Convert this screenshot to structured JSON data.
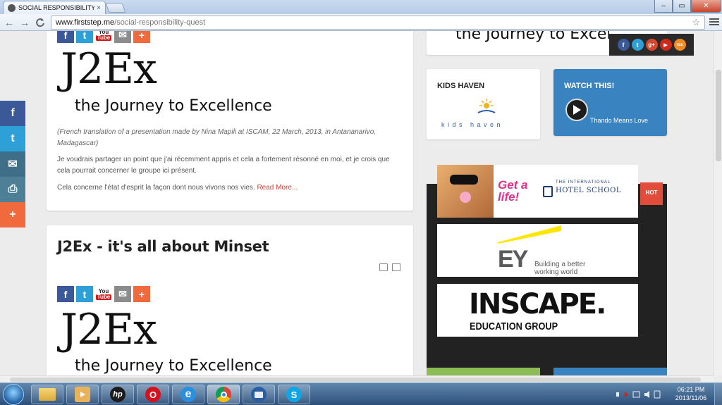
{
  "browser": {
    "tab_title": "SOCIAL RESPONSIBILITY Q",
    "tab_close": "×",
    "url_host": "www.firststep.me",
    "url_path": "/social-responsibility-quest",
    "back": "←",
    "forward": "→",
    "reload": "C",
    "star": "☆",
    "window_min": "–",
    "window_max": "▭",
    "window_close": "✕"
  },
  "float_share": [
    {
      "icon": "facebook-icon",
      "glyph": "f"
    },
    {
      "icon": "twitter-icon",
      "glyph": "t"
    },
    {
      "icon": "email-icon",
      "glyph": "✉"
    },
    {
      "icon": "print-icon",
      "glyph": "⎙"
    },
    {
      "icon": "plus-icon",
      "glyph": "+"
    }
  ],
  "share_icons": {
    "facebook": "f",
    "twitter": "t",
    "youtube_top": "You",
    "youtube_bottom": "Tube",
    "email": "✉",
    "plus": "+"
  },
  "post1": {
    "logo_main": "J2Ex",
    "logo_sub": "the Journey to Excellence",
    "caption": "(French translation of a presentation made by Nina Mapili at ISCAM, 22 March, 2013, in Antananarivo, Madagascar)",
    "para1": "Je voudrais partager un point que j'ai récemment appris et cela a fortement résonné en moi, et je crois que cela pourrait concerner le groupe ici présent.",
    "para2": "Cela concerne l'état d'esprit la façon dont nous vivons nos vies.",
    "read_more": "Read More..."
  },
  "post2": {
    "title": "J2Ex - it's all about Minset",
    "logo_main": "J2Ex",
    "logo_sub": "the Journey to Excellence"
  },
  "right_column": {
    "top_logo_fragment": "the Journey to Excellence",
    "social_strip": [
      "f",
      "t",
      "g+",
      "▶",
      "rss"
    ],
    "kids_haven": {
      "title": "KIDS HAVEN",
      "logo_text": "kids haven"
    },
    "watch_this": {
      "title": "WATCH THIS!",
      "video_label": "Thando Means Love"
    },
    "hot_tag": "HOT",
    "ads": {
      "hotel_tagline": "Get a life!",
      "hotel_name_small": "THE INTERNATIONAL",
      "hotel_name": "HOTEL SCHOOL",
      "ey_logo": "EY",
      "ey_tag1": "Building a better",
      "ey_tag2": "working world",
      "inscape_logo": "INSCAPE.",
      "inscape_sub": "EDUCATION GROUP"
    }
  },
  "taskbar": {
    "apps": [
      "explorer",
      "media-player",
      "hp",
      "opera",
      "internet-explorer",
      "chrome",
      "thunderbird",
      "skype"
    ],
    "hp_label": "hp",
    "opera_label": "O",
    "ie_label": "e",
    "skype_label": "S",
    "time": "06:21 PM",
    "date": "2013/11/06"
  },
  "colors": {
    "facebook": "#3b5998",
    "twitter": "#2da0d8",
    "watch_this_bg": "#3a83c1",
    "hot_tag": "#e14c3b",
    "read_more": "#d23c3c"
  }
}
